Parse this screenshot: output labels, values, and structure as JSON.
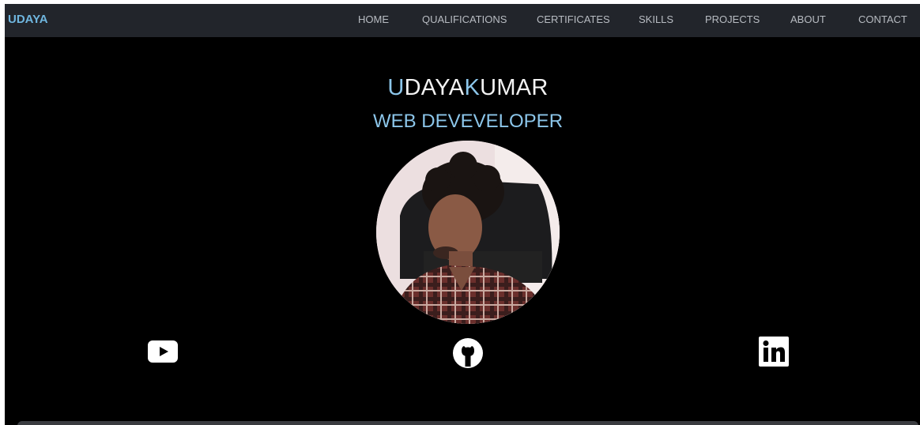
{
  "nav": {
    "brand": "UDAYA",
    "links": [
      "HOME",
      "QUALIFICATIONS",
      "CERTIFICATES",
      "SKILLS",
      "PROJECTS",
      "ABOUT",
      "CONTACT"
    ]
  },
  "hero": {
    "name_parts": [
      "U",
      "DAYA",
      "K",
      "UMAR"
    ],
    "role": "WEB DEVEVELOPER",
    "photo": "profile-photo"
  },
  "social": [
    {
      "icon": "youtube-icon"
    },
    {
      "icon": "github-icon"
    },
    {
      "icon": "linkedin-icon"
    }
  ],
  "colors": {
    "accent": "#8cc6ea",
    "brand": "#6fb6df",
    "navbar_bg": "#22252b",
    "page_bg": "#000000"
  }
}
